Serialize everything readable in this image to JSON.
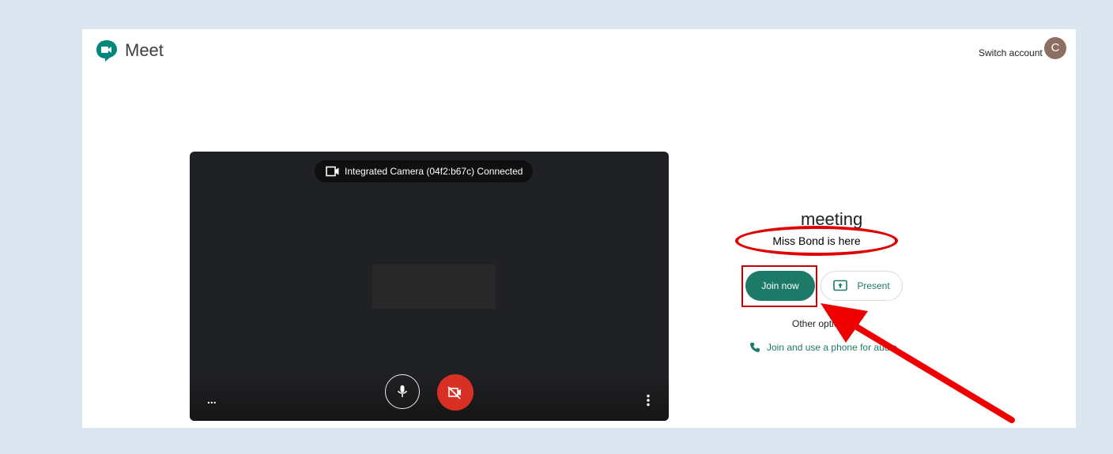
{
  "header": {
    "app_name": "Meet",
    "switch_account": "Switch account",
    "avatar_letter": "C"
  },
  "preview": {
    "camera_status": "Integrated Camera (04f2:b67c)  Connected",
    "more_dots": "...",
    "mic_state": "on",
    "camera_state": "off"
  },
  "right_pane": {
    "title_fragment": "meeting",
    "annotation_text": "Miss Bond is here",
    "join_label": "Join now",
    "present_label": "Present",
    "other_options": "Other options",
    "phone_option": "Join and use a phone for audio"
  },
  "colors": {
    "accent": "#1e7a68",
    "annotation_red": "#e00000",
    "camera_off_red": "#d93025",
    "background": "#dce6f1"
  },
  "icons": [
    "meet-logo-icon",
    "camera-icon",
    "mic-icon",
    "camera-off-icon",
    "more-vert-icon",
    "present-screen-icon",
    "phone-icon"
  ]
}
